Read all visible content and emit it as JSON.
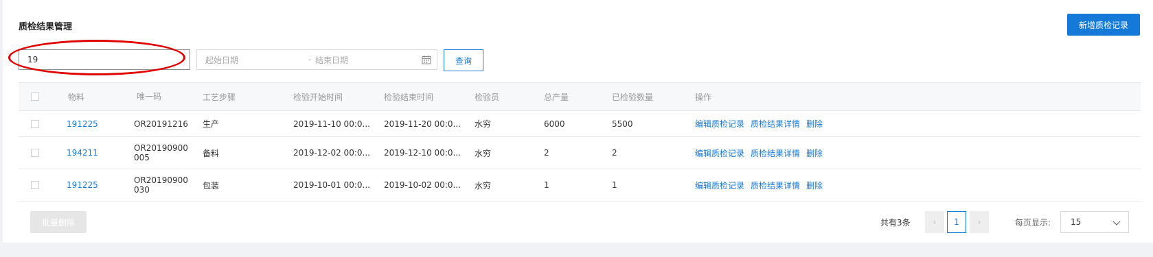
{
  "header": {
    "title": "质检结果管理",
    "add_button": "新增质检记录"
  },
  "search": {
    "value": "19",
    "start_placeholder": "起始日期",
    "separator": "-",
    "end_placeholder": "结束日期",
    "query_button": "查询"
  },
  "table": {
    "columns": [
      "物料",
      "唯一码",
      "工艺步骤",
      "检验开始时间",
      "检验结束时间",
      "检验员",
      "总产量",
      "已检验数量",
      "操作"
    ],
    "rows": [
      {
        "material": "191225",
        "uid": [
          "OR20191216"
        ],
        "step": "生产",
        "start": "2019-11-10 00:0...",
        "end": "2019-11-20 00:0...",
        "inspector": "水穷",
        "total": "6000",
        "inspected": "5500"
      },
      {
        "material": "194211",
        "uid": [
          "OR20190900",
          "005"
        ],
        "step": "备料",
        "start": "2019-12-02 00:0...",
        "end": "2019-12-10 00:0...",
        "inspector": "水穷",
        "total": "2",
        "inspected": "2"
      },
      {
        "material": "191225",
        "uid": [
          "OR20190900",
          "030"
        ],
        "step": "包装",
        "start": "2019-10-01 00:0...",
        "end": "2019-10-02 00:0...",
        "inspector": "水穷",
        "total": "1",
        "inspected": "1"
      }
    ],
    "actions": [
      "编辑质检记录",
      "质检结果详情",
      "删除"
    ]
  },
  "footer": {
    "batch_delete": "批量删除",
    "total_text": "共有3条",
    "prev": "‹",
    "current_page": "1",
    "next": "›",
    "page_size_label": "每页显示:",
    "page_size_value": "15"
  },
  "colors": {
    "primary": "#1479d7",
    "highlight_ellipse": "#e00000"
  }
}
